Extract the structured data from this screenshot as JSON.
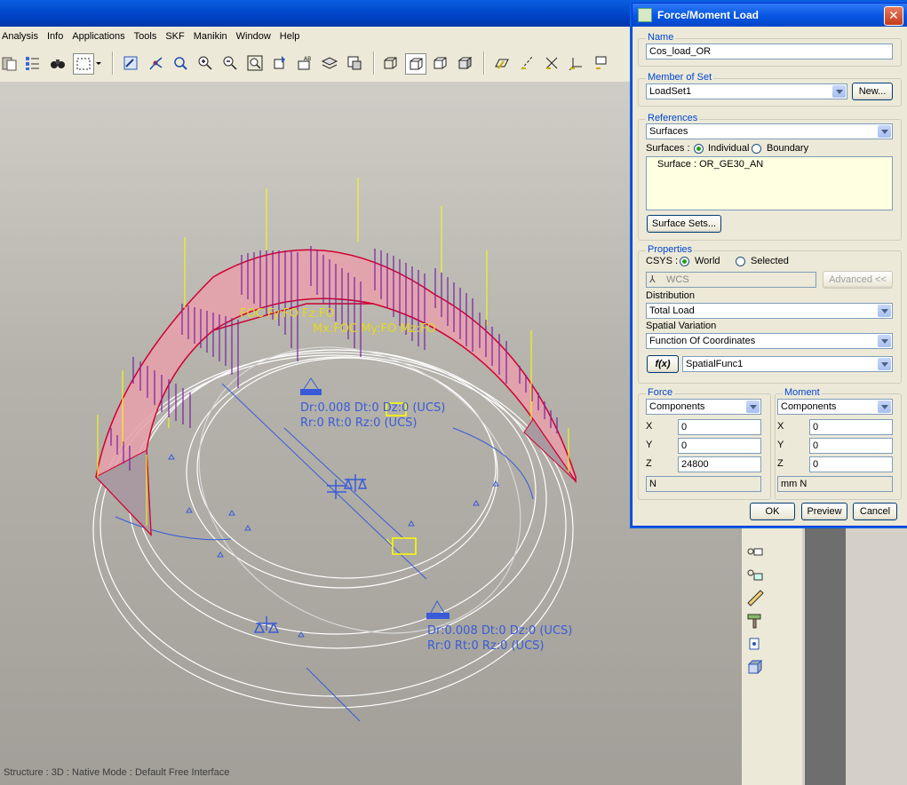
{
  "menu": [
    "Analysis",
    "Info",
    "Applications",
    "Tools",
    "SKF",
    "Manikin",
    "Window",
    "Help"
  ],
  "toolbar_icons": [
    "paste-icon",
    "regenerate-icon",
    "binoculars-icon",
    "select-box-icon",
    "repaint-icon",
    "spin-center-icon",
    "orient-icon",
    "zoom-in-icon",
    "zoom-out-icon",
    "refit-icon",
    "reorient-icon",
    "named-view-icon",
    "layers-icon",
    "view-manager-icon",
    "wireframe-icon",
    "hidden-line-icon",
    "no-hidden-icon",
    "shading-icon",
    "datum-planes-icon",
    "datum-axes-icon",
    "datum-points-icon",
    "csys-icon",
    "annotations-icon"
  ],
  "viewport": {
    "annotation_top": "Dr:0.008  Dt:0  Dz:0 (UCS)",
    "annotation_top_2": "Rr:0 Rt:0 Rz:0 (UCS)",
    "annotation_bottom": "Dr:0.008  Dt:0  Dz:0 (UCS)",
    "annotation_bottom_2": "Rr:0 Rt:0 Rz:0 (UCS)",
    "load_label_1": "FOC Fy:FO Fz:FO",
    "load_label_2": "Mx:FOC My:FO Mz:FO"
  },
  "status": "Structure : 3D : Native Mode : Default Free Interface",
  "dialog": {
    "title": "Force/Moment Load",
    "name_label": "Name",
    "name_value": "Cos_load_OR",
    "member_label": "Member of Set",
    "member_value": "LoadSet1",
    "new_button": "New...",
    "references_label": "References",
    "references_value": "Surfaces",
    "surfaces_label": "Surfaces :",
    "individual_label": "Individual",
    "boundary_label": "Boundary",
    "surface_item": "Surface : OR_GE30_AN",
    "surface_sets_button": "Surface Sets...",
    "properties_label": "Properties",
    "csys_label": "CSYS :",
    "world_label": "World",
    "selected_label": "Selected",
    "csys_field": "WCS",
    "advanced_button": "Advanced <<",
    "distribution_label": "Distribution",
    "distribution_value": "Total Load",
    "spatial_label": "Spatial Variation",
    "spatial_value": "Function Of Coordinates",
    "fx_button": "f(x)",
    "function_value": "SpatialFunc1",
    "force_label": "Force",
    "force_mode": "Components",
    "force_x_label": "X",
    "force_x": "0",
    "force_y_label": "Y",
    "force_y": "0",
    "force_z_label": "Z",
    "force_z": "24800",
    "force_unit": "N",
    "moment_label": "Moment",
    "moment_mode": "Components",
    "moment_x_label": "X",
    "moment_x": "0",
    "moment_y_label": "Y",
    "moment_y": "0",
    "moment_z_label": "Z",
    "moment_z": "0",
    "moment_unit": "mm N",
    "ok_button": "OK",
    "preview_button": "Preview",
    "cancel_button": "Cancel"
  },
  "colors": {
    "accent": "#0046d5",
    "load_arrow": "#7b1fa2",
    "yellow": "#ffff00",
    "surface": "#e8a0ac",
    "constraint": "#3a5bd9"
  }
}
